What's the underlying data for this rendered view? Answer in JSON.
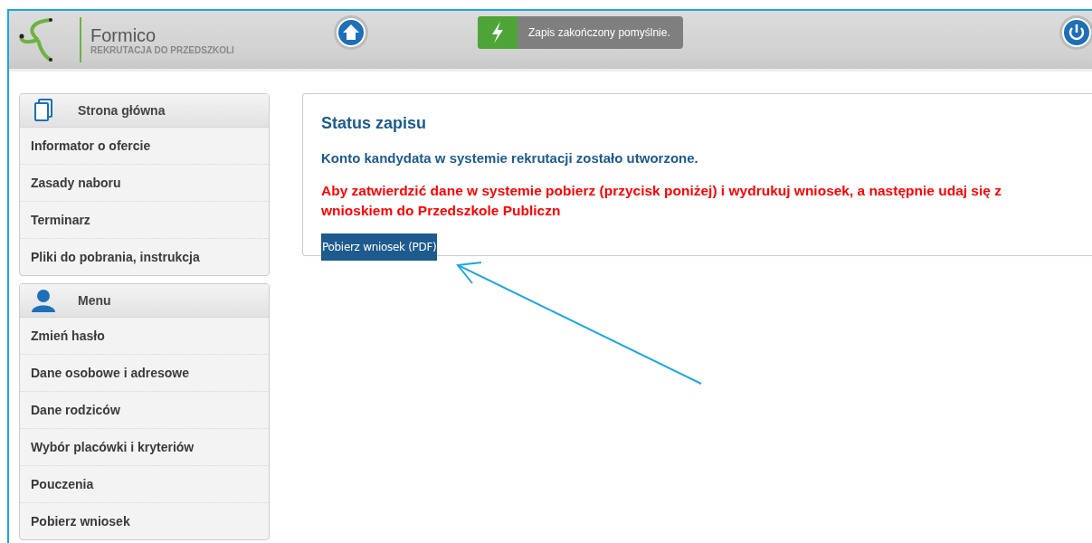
{
  "header": {
    "app_name": "Formico",
    "app_subtitle": "REKRUTACJA DO PRZEDSZKOLI",
    "notification": "Zapis zakończony pomyślnie."
  },
  "sidebar": [
    {
      "title": "Strona główna",
      "kind": "pages",
      "items": [
        "Informator o ofercie",
        "Zasady naboru",
        "Terminarz",
        "Pliki do pobrania, instrukcja"
      ]
    },
    {
      "title": "Menu",
      "kind": "user",
      "items": [
        "Zmień hasło",
        "Dane osobowe i adresowe",
        "Dane rodziców",
        "Wybór placówki i kryteriów",
        "Pouczenia",
        "Pobierz wniosek"
      ]
    }
  ],
  "status": {
    "title": "Status zapisu",
    "message": "Konto kandydata w systemie rekrutacji zostało utworzone.",
    "warning": "Aby zatwierdzić dane w systemie pobierz (przycisk poniżej) i wydrukuj wniosek, a następnie udaj się z wnioskiem do Przedszkole Publiczn",
    "button": "Pobierz wniosek (PDF)"
  }
}
